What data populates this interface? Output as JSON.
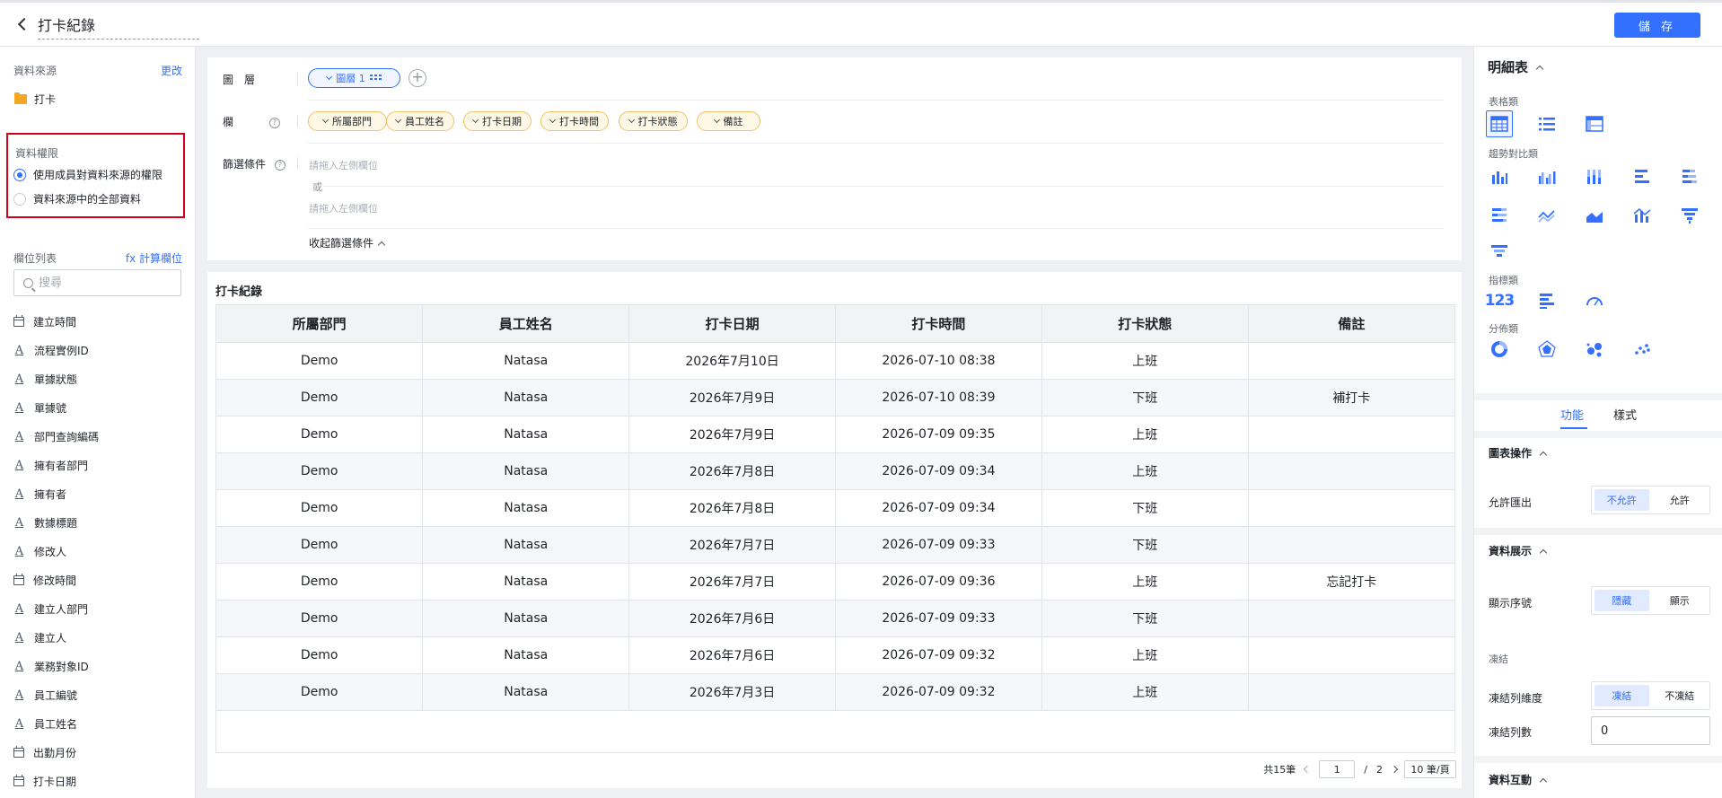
{
  "header": {
    "title": "打卡紀錄",
    "save_label": "儲 存"
  },
  "left": {
    "source_label": "資料來源",
    "change_link": "更改",
    "source_name": "打卡",
    "permission_label": "資料權限",
    "permission_options": [
      "使用成員對資料來源的權限",
      "資料來源中的全部資料"
    ],
    "fields_label": "欄位列表",
    "calc_link": "fx 計算欄位",
    "search_placeholder": "搜尋",
    "fields": [
      {
        "label": "建立時間",
        "type": "date"
      },
      {
        "label": "流程實例ID",
        "type": "text"
      },
      {
        "label": "單據狀態",
        "type": "text"
      },
      {
        "label": "單據號",
        "type": "text"
      },
      {
        "label": "部門查詢編碼",
        "type": "text"
      },
      {
        "label": "擁有者部門",
        "type": "text"
      },
      {
        "label": "擁有者",
        "type": "text"
      },
      {
        "label": "數據標題",
        "type": "text"
      },
      {
        "label": "修改人",
        "type": "text"
      },
      {
        "label": "修改時間",
        "type": "date"
      },
      {
        "label": "建立人部門",
        "type": "text"
      },
      {
        "label": "建立人",
        "type": "text"
      },
      {
        "label": "業務對象ID",
        "type": "text"
      },
      {
        "label": "員工編號",
        "type": "text"
      },
      {
        "label": "員工姓名",
        "type": "text"
      },
      {
        "label": "出勤月份",
        "type": "date"
      },
      {
        "label": "打卡日期",
        "type": "date"
      }
    ]
  },
  "config": {
    "layer_label": "圖　層",
    "layer_pill": "圖層 1",
    "columns_label": "欄",
    "columns": [
      "所屬部門",
      "員工姓名",
      "打卡日期",
      "打卡時間",
      "打卡狀態",
      "備註"
    ],
    "filter_label": "篩選條件",
    "filter_placeholder": "請拖入左側欄位",
    "or_label": "或",
    "filter_placeholder2": "請拖入左側欄位",
    "collapse_label": "收起篩選條件"
  },
  "table": {
    "title": "打卡紀錄",
    "headers": [
      "所屬部門",
      "員工姓名",
      "打卡日期",
      "打卡時間",
      "打卡狀態",
      "備註"
    ],
    "rows": [
      [
        "Demo",
        "Natasa",
        "2026年7月10日",
        "2026-07-10 08:38",
        "上班",
        ""
      ],
      [
        "Demo",
        "Natasa",
        "2026年7月9日",
        "2026-07-10 08:39",
        "下班",
        "補打卡"
      ],
      [
        "Demo",
        "Natasa",
        "2026年7月9日",
        "2026-07-09 09:35",
        "上班",
        ""
      ],
      [
        "Demo",
        "Natasa",
        "2026年7月8日",
        "2026-07-09 09:34",
        "上班",
        ""
      ],
      [
        "Demo",
        "Natasa",
        "2026年7月8日",
        "2026-07-09 09:34",
        "下班",
        ""
      ],
      [
        "Demo",
        "Natasa",
        "2026年7月7日",
        "2026-07-09 09:33",
        "下班",
        ""
      ],
      [
        "Demo",
        "Natasa",
        "2026年7月7日",
        "2026-07-09 09:36",
        "上班",
        "忘記打卡"
      ],
      [
        "Demo",
        "Natasa",
        "2026年7月6日",
        "2026-07-09 09:33",
        "下班",
        ""
      ],
      [
        "Demo",
        "Natasa",
        "2026年7月6日",
        "2026-07-09 09:32",
        "上班",
        ""
      ],
      [
        "Demo",
        "Natasa",
        "2026年7月3日",
        "2026-07-09 09:32",
        "上班",
        ""
      ]
    ],
    "pager": {
      "total": "共15筆",
      "current_page": "1",
      "separator": "/",
      "total_pages": "2",
      "page_size": "10 筆/頁"
    }
  },
  "right": {
    "title": "明細表",
    "group_table": "表格類",
    "group_trend": "趨勢對比類",
    "group_kpi": "指標類",
    "group_dist": "分佈類",
    "kpi_icon_text": "123",
    "tabs": [
      "功能",
      "樣式"
    ],
    "section_chart_ops": "圖表操作",
    "allow_export_label": "允許匯出",
    "allow_export_options": [
      "不允許",
      "允許"
    ],
    "section_display": "資料展示",
    "show_index_label": "顯示序號",
    "show_index_options": [
      "隱藏",
      "顯示"
    ],
    "freeze_label": "凍結",
    "freeze_col_label": "凍結列維度",
    "freeze_col_options": [
      "凍結",
      "不凍結"
    ],
    "freeze_count_label": "凍結列數",
    "freeze_count_value": "0",
    "section_interact": "資料互動"
  },
  "colors": {
    "accent": "#3370ff",
    "highlight_border": "#d0021b",
    "pill_column": "#f0c36b"
  }
}
